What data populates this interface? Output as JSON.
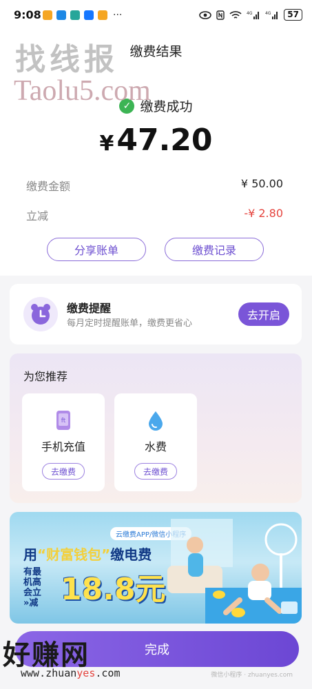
{
  "status_bar": {
    "time": "9:08",
    "more": "···",
    "battery": "57"
  },
  "header": {
    "title": "缴费结果"
  },
  "watermarks": {
    "top": "找线报",
    "taolu": "Taolu5.com",
    "zhuan": "好赚网",
    "url_pre": "www.zhuan",
    "url_hl": "yes",
    "url_post": ".com",
    "small": "微信小程序 · zhuanyes.com"
  },
  "result": {
    "status_text": "缴费成功",
    "currency": "¥",
    "amount": "47.20",
    "rows": [
      {
        "label": "缴费金额",
        "value": "¥ 50.00"
      },
      {
        "label": "立减",
        "value": "-¥ 2.80"
      }
    ],
    "share_button": "分享账单",
    "records_button": "缴费记录"
  },
  "reminder": {
    "title": "缴费提醒",
    "subtitle": "每月定时提醒账单，缴费更省心",
    "button": "去开启"
  },
  "recommend": {
    "title": "为您推荐",
    "items": [
      {
        "label": "手机充值",
        "button": "去缴费",
        "icon": "phone-icon"
      },
      {
        "label": "水费",
        "button": "去缴费",
        "icon": "water-drop-icon"
      }
    ]
  },
  "banner": {
    "tag": "云缴费APP/微信小程序",
    "head_pre": "用",
    "head_quote": "“财富钱包”",
    "head_post": "缴电费",
    "side_lines": [
      "有最",
      "机高",
      "会立",
      "»减"
    ],
    "amount": "18.8元"
  },
  "bottom": {
    "done_button": "完成"
  },
  "colors": {
    "accent": "#7a55d8",
    "success": "#3cb454",
    "discount": "#e5423c"
  }
}
